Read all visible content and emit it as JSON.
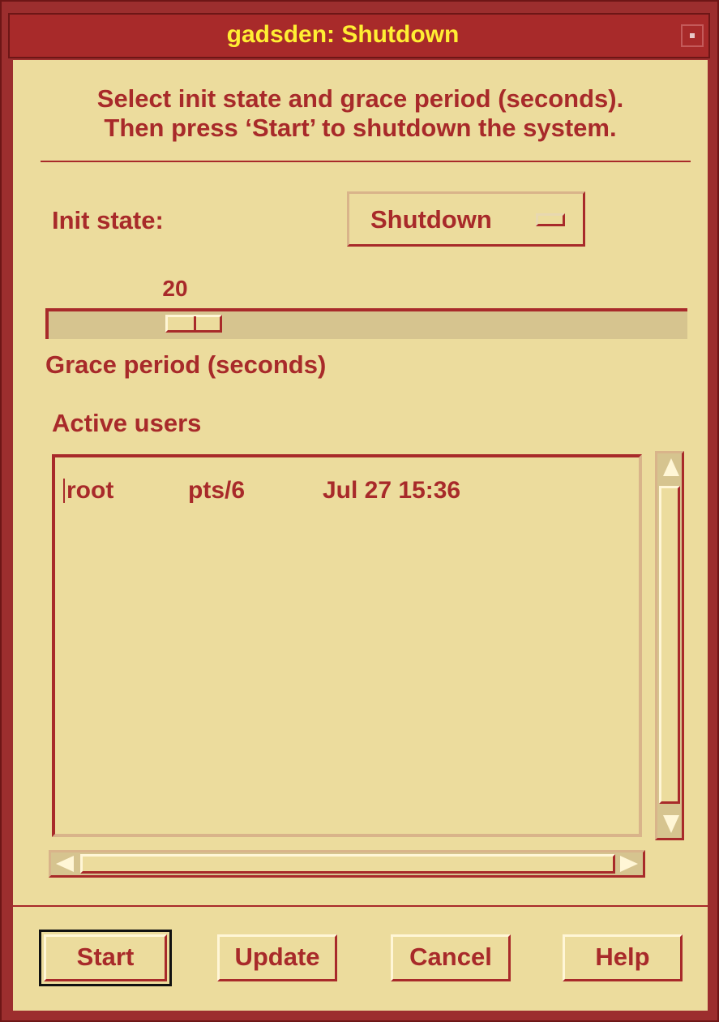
{
  "window": {
    "title": "gadsden: Shutdown"
  },
  "instructions": {
    "line1": "Select init state and grace period (seconds).",
    "line2": "Then press ‘Start’ to shutdown the system."
  },
  "init_state": {
    "label": "Init state:",
    "value": "Shutdown"
  },
  "grace": {
    "value": "20",
    "label": "Grace period (seconds)",
    "fraction": 0.2
  },
  "users": {
    "label": "Active users",
    "rows": [
      {
        "user": "root",
        "tty": "pts/6",
        "time": "Jul 27 15:36"
      }
    ]
  },
  "buttons": {
    "start": "Start",
    "update": "Update",
    "cancel": "Cancel",
    "help": "Help"
  },
  "colors": {
    "background": "#ecdc9d",
    "text": "#a82a2a",
    "title_text": "#ffee33"
  }
}
